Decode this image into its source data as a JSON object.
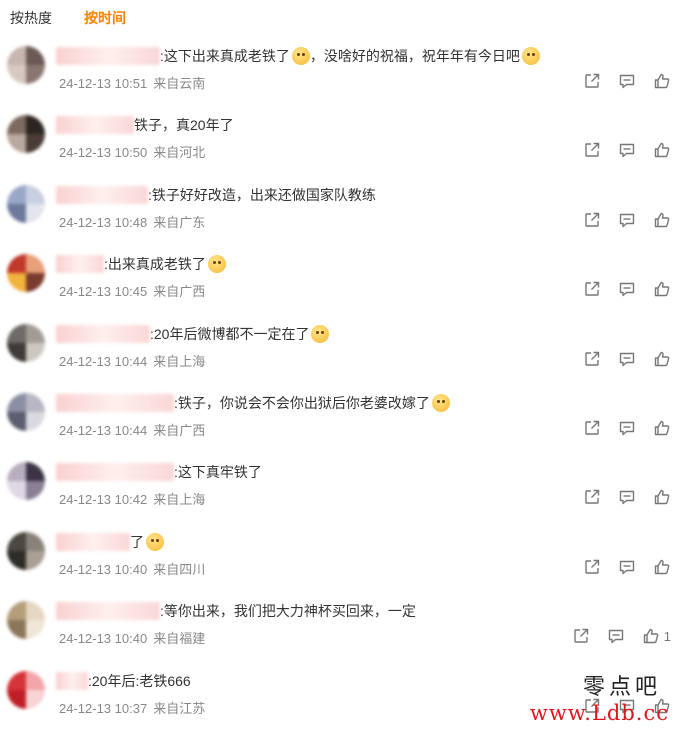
{
  "tabs": [
    {
      "label": "按热度",
      "active": false
    },
    {
      "label": "按时间",
      "active": true
    }
  ],
  "colors": {
    "accent": "#ff8200",
    "meta": "#888888",
    "watermark_red": "#e0161e"
  },
  "icons": {
    "share": "share-icon",
    "comment": "comment-icon",
    "like": "thumbs-up-icon"
  },
  "comments": [
    {
      "text": ":这下出来真成老铁了",
      "tail": "，没啥好的祝福，祝年年有今日吧",
      "emoji": true,
      "emoji2": true,
      "time": "24-12-13 10:51",
      "location": "来自云南",
      "likes": ""
    },
    {
      "text": "铁子，真20年了",
      "tail": "",
      "emoji": false,
      "emoji2": false,
      "time": "24-12-13 10:50",
      "location": "来自河北",
      "likes": ""
    },
    {
      "text": ":铁子好好改造，出来还做国家队教练",
      "tail": "",
      "emoji": false,
      "emoji2": false,
      "time": "24-12-13 10:48",
      "location": "来自广东",
      "likes": ""
    },
    {
      "text": ":出来真成老铁了",
      "tail": "",
      "emoji": true,
      "emoji2": false,
      "time": "24-12-13 10:45",
      "location": "来自广西",
      "likes": ""
    },
    {
      "text": ":20年后微博都不一定在了",
      "tail": "",
      "emoji": true,
      "emoji2": false,
      "time": "24-12-13 10:44",
      "location": "来自上海",
      "likes": ""
    },
    {
      "text": ":铁子，你说会不会你出狱后你老婆改嫁了",
      "tail": "",
      "emoji": true,
      "emoji2": false,
      "time": "24-12-13 10:44",
      "location": "来自广西",
      "likes": ""
    },
    {
      "text": ":这下真牢铁了",
      "tail": "",
      "emoji": false,
      "emoji2": false,
      "time": "24-12-13 10:42",
      "location": "来自上海",
      "likes": ""
    },
    {
      "text": "了",
      "tail": "",
      "emoji": true,
      "emoji2": false,
      "time": "24-12-13 10:40",
      "location": "来自四川",
      "likes": ""
    },
    {
      "text": ":等你出来，我们把大力神杯买回来，一定",
      "tail": "",
      "emoji": false,
      "emoji2": false,
      "time": "24-12-13 10:40",
      "location": "来自福建",
      "likes": "1"
    },
    {
      "text": ":20年后:老铁666",
      "tail": "",
      "emoji": false,
      "emoji2": false,
      "time": "24-12-13 10:37",
      "location": "来自江苏",
      "likes": ""
    }
  ],
  "watermark": {
    "top": "零点吧",
    "bottom": "www.Ldb.cc"
  }
}
